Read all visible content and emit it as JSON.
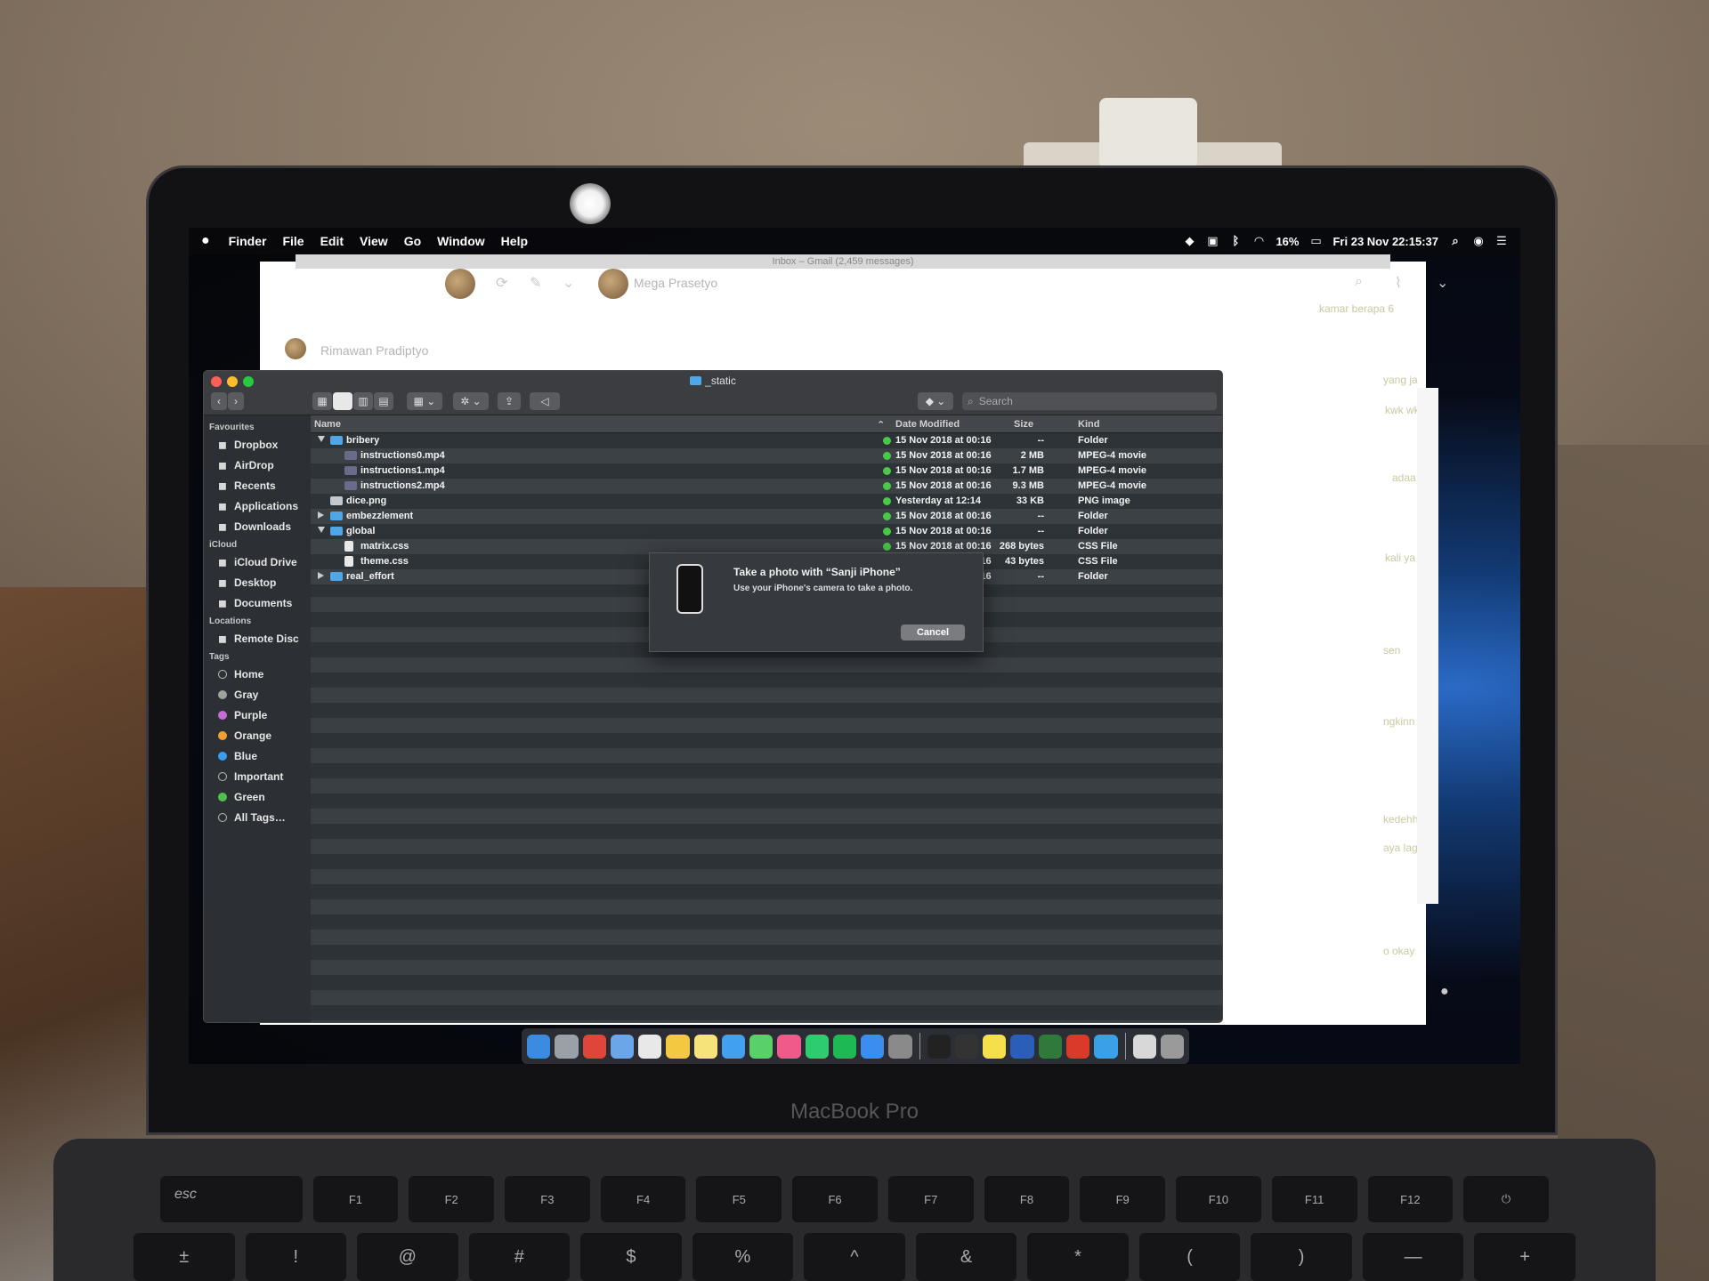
{
  "menubar": {
    "items": [
      "Finder",
      "File",
      "Edit",
      "View",
      "Go",
      "Window",
      "Help"
    ],
    "battery": "16%",
    "datetime": "Fri 23 Nov  22:15:37"
  },
  "gmail": {
    "window_title": "Inbox – Gmail (2,459 messages)",
    "sender_top": "Mega Prasetyo",
    "sender_list": "Rimawan Pradiptyo",
    "snippets": [
      "kamar berapa 6",
      "yang ja",
      "kwk wk",
      "adaa",
      "kali ya",
      "sen",
      "ngkinn",
      "kedehh",
      "aya lagi",
      "o okay"
    ]
  },
  "finder": {
    "title": "_static",
    "search_placeholder": "Search",
    "sidebar": {
      "favourites_label": "Favourites",
      "favourites": [
        {
          "label": "Dropbox",
          "icon": "dropbox-icon"
        },
        {
          "label": "AirDrop",
          "icon": "airdrop-icon"
        },
        {
          "label": "Recents",
          "icon": "recents-icon"
        },
        {
          "label": "Applications",
          "icon": "applications-icon"
        },
        {
          "label": "Downloads",
          "icon": "downloads-icon"
        }
      ],
      "icloud_label": "iCloud",
      "icloud": [
        {
          "label": "iCloud Drive",
          "icon": "cloud-icon"
        },
        {
          "label": "Desktop",
          "icon": "desktop-icon"
        },
        {
          "label": "Documents",
          "icon": "documents-icon"
        }
      ],
      "locations_label": "Locations",
      "locations": [
        {
          "label": "Remote Disc",
          "icon": "disc-icon"
        }
      ],
      "tags_label": "Tags",
      "tags": [
        {
          "label": "Home",
          "color": "transparent"
        },
        {
          "label": "Gray",
          "color": "#a0a0a0"
        },
        {
          "label": "Purple",
          "color": "#c86ad8"
        },
        {
          "label": "Orange",
          "color": "#f0a030"
        },
        {
          "label": "Blue",
          "color": "#3a9ef0"
        },
        {
          "label": "Important",
          "color": "transparent"
        },
        {
          "label": "Green",
          "color": "#50c050"
        },
        {
          "label": "All Tags…",
          "color": "transparent"
        }
      ]
    },
    "columns": {
      "name": "Name",
      "date": "Date Modified",
      "size": "Size",
      "kind": "Kind"
    },
    "rows": [
      {
        "name": "bribery",
        "indent": 0,
        "type": "folder",
        "disclosure": "open",
        "date": "15 Nov 2018 at 00:16",
        "size": "--",
        "kind": "Folder"
      },
      {
        "name": "instructions0.mp4",
        "indent": 1,
        "type": "movie",
        "disclosure": "",
        "date": "15 Nov 2018 at 00:16",
        "size": "2 MB",
        "kind": "MPEG-4 movie"
      },
      {
        "name": "instructions1.mp4",
        "indent": 1,
        "type": "movie",
        "disclosure": "",
        "date": "15 Nov 2018 at 00:16",
        "size": "1.7 MB",
        "kind": "MPEG-4 movie"
      },
      {
        "name": "instructions2.mp4",
        "indent": 1,
        "type": "movie",
        "disclosure": "",
        "date": "15 Nov 2018 at 00:16",
        "size": "9.3 MB",
        "kind": "MPEG-4 movie"
      },
      {
        "name": "dice.png",
        "indent": 0,
        "type": "image",
        "disclosure": "",
        "date": "Yesterday at 12:14",
        "size": "33 KB",
        "kind": "PNG image"
      },
      {
        "name": "embezzlement",
        "indent": 0,
        "type": "folder",
        "disclosure": "closed",
        "date": "15 Nov 2018 at 00:16",
        "size": "--",
        "kind": "Folder"
      },
      {
        "name": "global",
        "indent": 0,
        "type": "folder",
        "disclosure": "open",
        "date": "15 Nov 2018 at 00:16",
        "size": "--",
        "kind": "Folder"
      },
      {
        "name": "matrix.css",
        "indent": 1,
        "type": "doc",
        "disclosure": "",
        "date": "15 Nov 2018 at 00:16",
        "size": "268 bytes",
        "kind": "CSS File"
      },
      {
        "name": "theme.css",
        "indent": 1,
        "type": "doc",
        "disclosure": "",
        "date": "15 Nov 2018 at 00:16",
        "size": "43 bytes",
        "kind": "CSS File"
      },
      {
        "name": "real_effort",
        "indent": 0,
        "type": "folder",
        "disclosure": "closed",
        "date": "15 Nov 2018 at 00:16",
        "size": "--",
        "kind": "Folder"
      }
    ]
  },
  "dialog": {
    "title": "Take a photo with “Sanji iPhone”",
    "subtitle": "Use your iPhone's camera to take a photo.",
    "cancel": "Cancel"
  },
  "dock": {
    "colors": [
      "#3b8be0",
      "#9aa0a8",
      "#e0453a",
      "#6aa6e8",
      "#e8e8e8",
      "#f5c842",
      "#f6e37a",
      "#42a0f0",
      "#5ad06a",
      "#f05a8a",
      "#2ecc71",
      "#1db954",
      "#3a8ef0",
      "#8a8a8a",
      "#222222",
      "#333333",
      "#f4e04a",
      "#2b5eb8",
      "#2f7a3a",
      "#d93a2a",
      "#3aa0e8",
      "#d8d8d8",
      "#9a9a9a"
    ]
  },
  "laptop": {
    "brand": "MacBook Pro",
    "fn_keys": [
      "F1",
      "F2",
      "F3",
      "F4",
      "F5",
      "F6",
      "F7",
      "F8",
      "F9",
      "F10",
      "F11",
      "F12"
    ],
    "esc": "esc",
    "number_row": [
      "±",
      "!",
      "@",
      "#",
      "$",
      "%",
      "^",
      "&",
      "*",
      "(",
      ")",
      "—",
      "+"
    ]
  }
}
